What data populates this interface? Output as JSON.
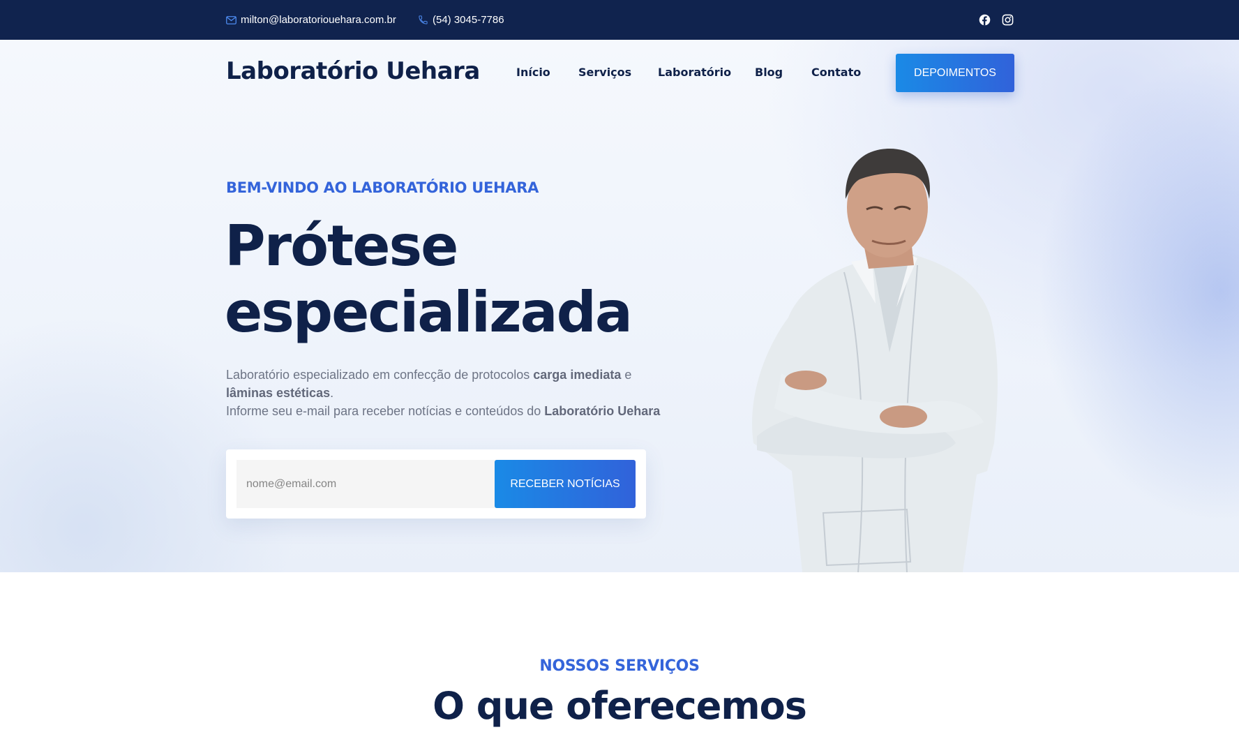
{
  "topbar": {
    "email": "milton@laboratoriouehara.com.br",
    "phone": "(54) 3045-7786",
    "social": [
      "facebook-icon",
      "instagram-icon"
    ]
  },
  "header": {
    "logo": "Laboratório Uehara",
    "nav": [
      "Início",
      "Serviços",
      "Laboratório",
      "Blog",
      "Contato"
    ],
    "cta": "DEPOIMENTOS"
  },
  "hero": {
    "kicker": "BEM-VINDO AO LABORATÓRIO UEHARA",
    "headline_line1": "Prótese",
    "headline_line2": "especializada",
    "desc": {
      "part1": "Laboratório especializado em confecção de protocolos ",
      "bold1": "carga imediata",
      "part2": " e ",
      "bold2": "lâminas estéticas",
      "part3": ".",
      "line2": "Informe seu e-mail para receber notícias e conteúdos do ",
      "bold3": "Laboratório Uehara"
    },
    "subscribe": {
      "email_value": "",
      "email_placeholder": "nome@email.com",
      "button": "RECEBER NOTÍCIAS"
    }
  },
  "services": {
    "kicker": "NOSSOS SERVIÇOS",
    "title": "O que oferecemos"
  },
  "colors": {
    "topbar": "#10234e",
    "navy": "#0f2149",
    "accent": "#3464da",
    "button_start": "#1a8ae6",
    "button_end": "#3162da"
  }
}
